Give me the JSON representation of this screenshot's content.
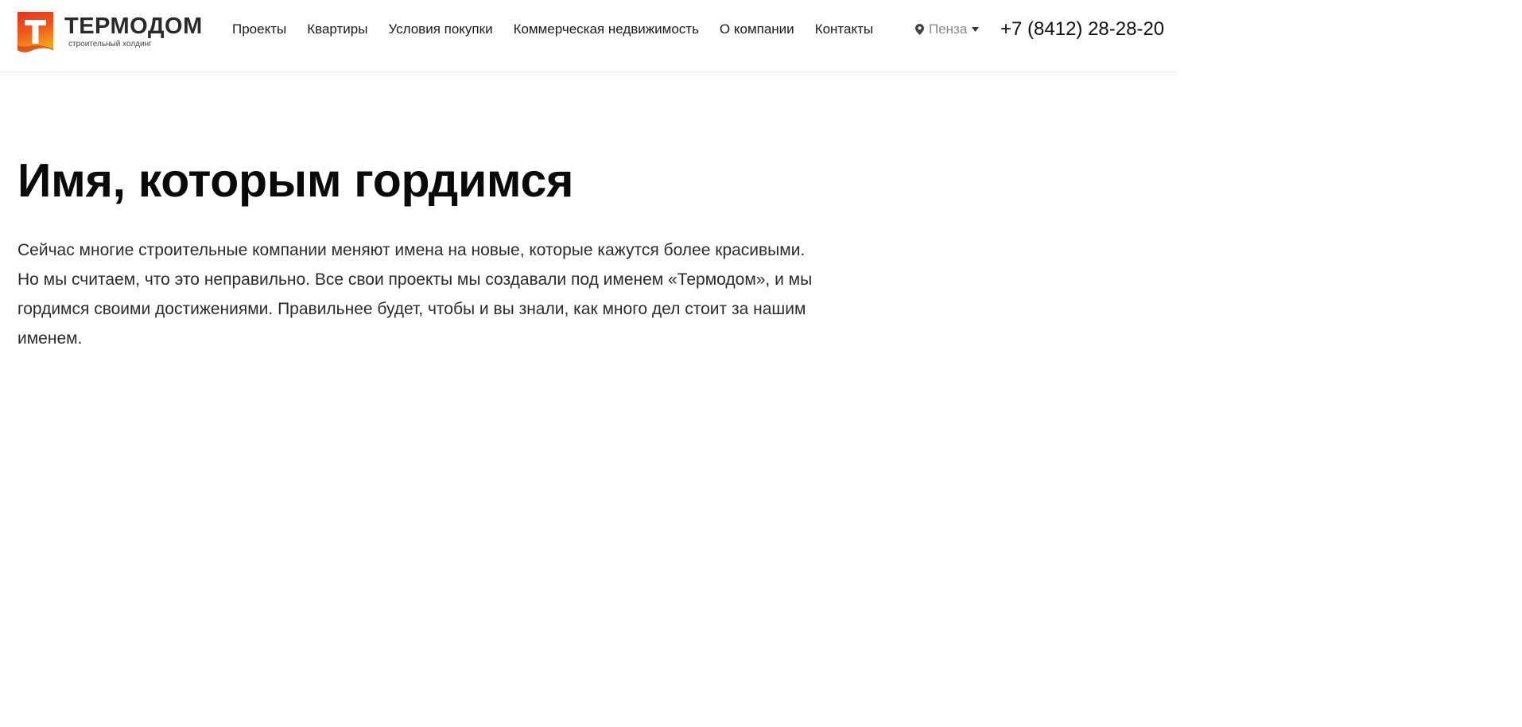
{
  "header": {
    "logo": {
      "title": "ТЕРМОДОМ",
      "subtitle": "строительный холдинг",
      "icon": "logo-t-mark"
    },
    "nav": [
      {
        "label": "Проекты"
      },
      {
        "label": "Квартиры"
      },
      {
        "label": "Условия покупки"
      },
      {
        "label": "Коммерческая недвижимость"
      },
      {
        "label": "О компании"
      },
      {
        "label": "Контакты"
      }
    ],
    "city": {
      "name": "Пенза",
      "icon": "location-pin-icon",
      "caret_icon": "caret-down-icon"
    },
    "phone": "+7 (8412) 28-28-20"
  },
  "main": {
    "title": "Имя, которым гордимся",
    "paragraph": "Сейчас многие строительные компании меняют имена на новые, которые кажутся более красивыми. Но мы считаем, что это неправильно. Все свои проекты мы создавали под именем «Термодом», и мы гордимся своими достижениями. Правильнее будет, чтобы и вы знали, как много дел стоит за нашим именем."
  },
  "colors": {
    "brand_red": "#e8321e",
    "brand_orange": "#f7941d",
    "text_dark": "#111111",
    "text_muted": "#8a8a8a"
  }
}
